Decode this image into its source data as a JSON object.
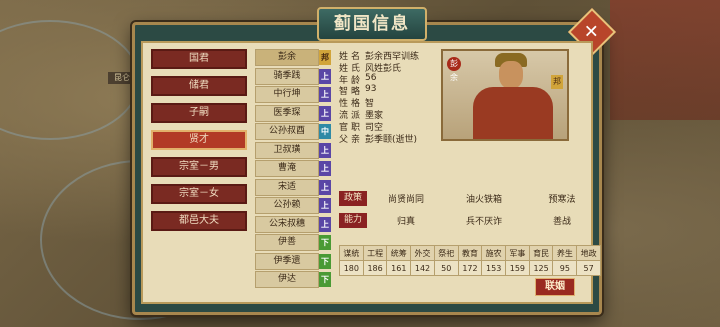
{
  "title": "蓟国信息",
  "map": {
    "city_label": "昆仑"
  },
  "categories": [
    {
      "label": "国君",
      "active": false
    },
    {
      "label": "储君",
      "active": false
    },
    {
      "label": "子嗣",
      "active": false
    },
    {
      "label": "贤才",
      "active": true
    },
    {
      "label": "宗室－男",
      "active": false
    },
    {
      "label": "宗室－女",
      "active": false
    },
    {
      "label": "都邑大夫",
      "active": false
    }
  ],
  "names": [
    {
      "name": "彭余",
      "badge": "邦",
      "badge_class": "b-bang",
      "selected": true
    },
    {
      "name": "骑季践",
      "badge": "上",
      "badge_class": "b-upper"
    },
    {
      "name": "中行坤",
      "badge": "上",
      "badge_class": "b-upper"
    },
    {
      "name": "医季琛",
      "badge": "上",
      "badge_class": "b-upper"
    },
    {
      "name": "公孙叔酉",
      "badge": "中",
      "badge_class": "b-mid"
    },
    {
      "name": "卫叔璜",
      "badge": "上",
      "badge_class": "b-upper"
    },
    {
      "name": "曹淹",
      "badge": "上",
      "badge_class": "b-upper"
    },
    {
      "name": "宋适",
      "badge": "上",
      "badge_class": "b-upper"
    },
    {
      "name": "公孙赖",
      "badge": "上",
      "badge_class": "b-upper"
    },
    {
      "name": "公宋叔穗",
      "badge": "上",
      "badge_class": "b-upper"
    },
    {
      "name": "伊善",
      "badge": "下",
      "badge_class": "b-lower"
    },
    {
      "name": "伊季遗",
      "badge": "下",
      "badge_class": "b-lower"
    },
    {
      "name": "伊达",
      "badge": "下",
      "badge_class": "b-lower"
    }
  ],
  "info": [
    {
      "label": "姓名",
      "value": "彭余西罕训练"
    },
    {
      "label": "姓氏",
      "value": "风姓彭氏"
    },
    {
      "label": "年龄",
      "value": "56"
    },
    {
      "label": "智略",
      "value": "93"
    },
    {
      "label": "性格",
      "value": "智"
    },
    {
      "label": "流派",
      "value": "墨家"
    },
    {
      "label": "官职",
      "value": "司空"
    },
    {
      "label": "父亲",
      "value": "彭季颐(逝世)"
    }
  ],
  "portrait": {
    "tag_left": "彭余",
    "tag_right": "邦"
  },
  "policy": {
    "key": "政策",
    "values": [
      "尚贤尚同",
      "油火铁箱",
      "预寒法"
    ]
  },
  "ability": {
    "key": "能力",
    "values": [
      "归真",
      "兵不厌诈",
      "善战"
    ]
  },
  "stats": {
    "headers": [
      "谋統",
      "工程",
      "统筹",
      "外交",
      "祭祀",
      "教育",
      "施农",
      "军事",
      "育民",
      "养生",
      "地政"
    ],
    "values": [
      "180",
      "186",
      "161",
      "142",
      "50",
      "172",
      "153",
      "159",
      "125",
      "95",
      "57"
    ]
  },
  "marry_button": "联姻"
}
